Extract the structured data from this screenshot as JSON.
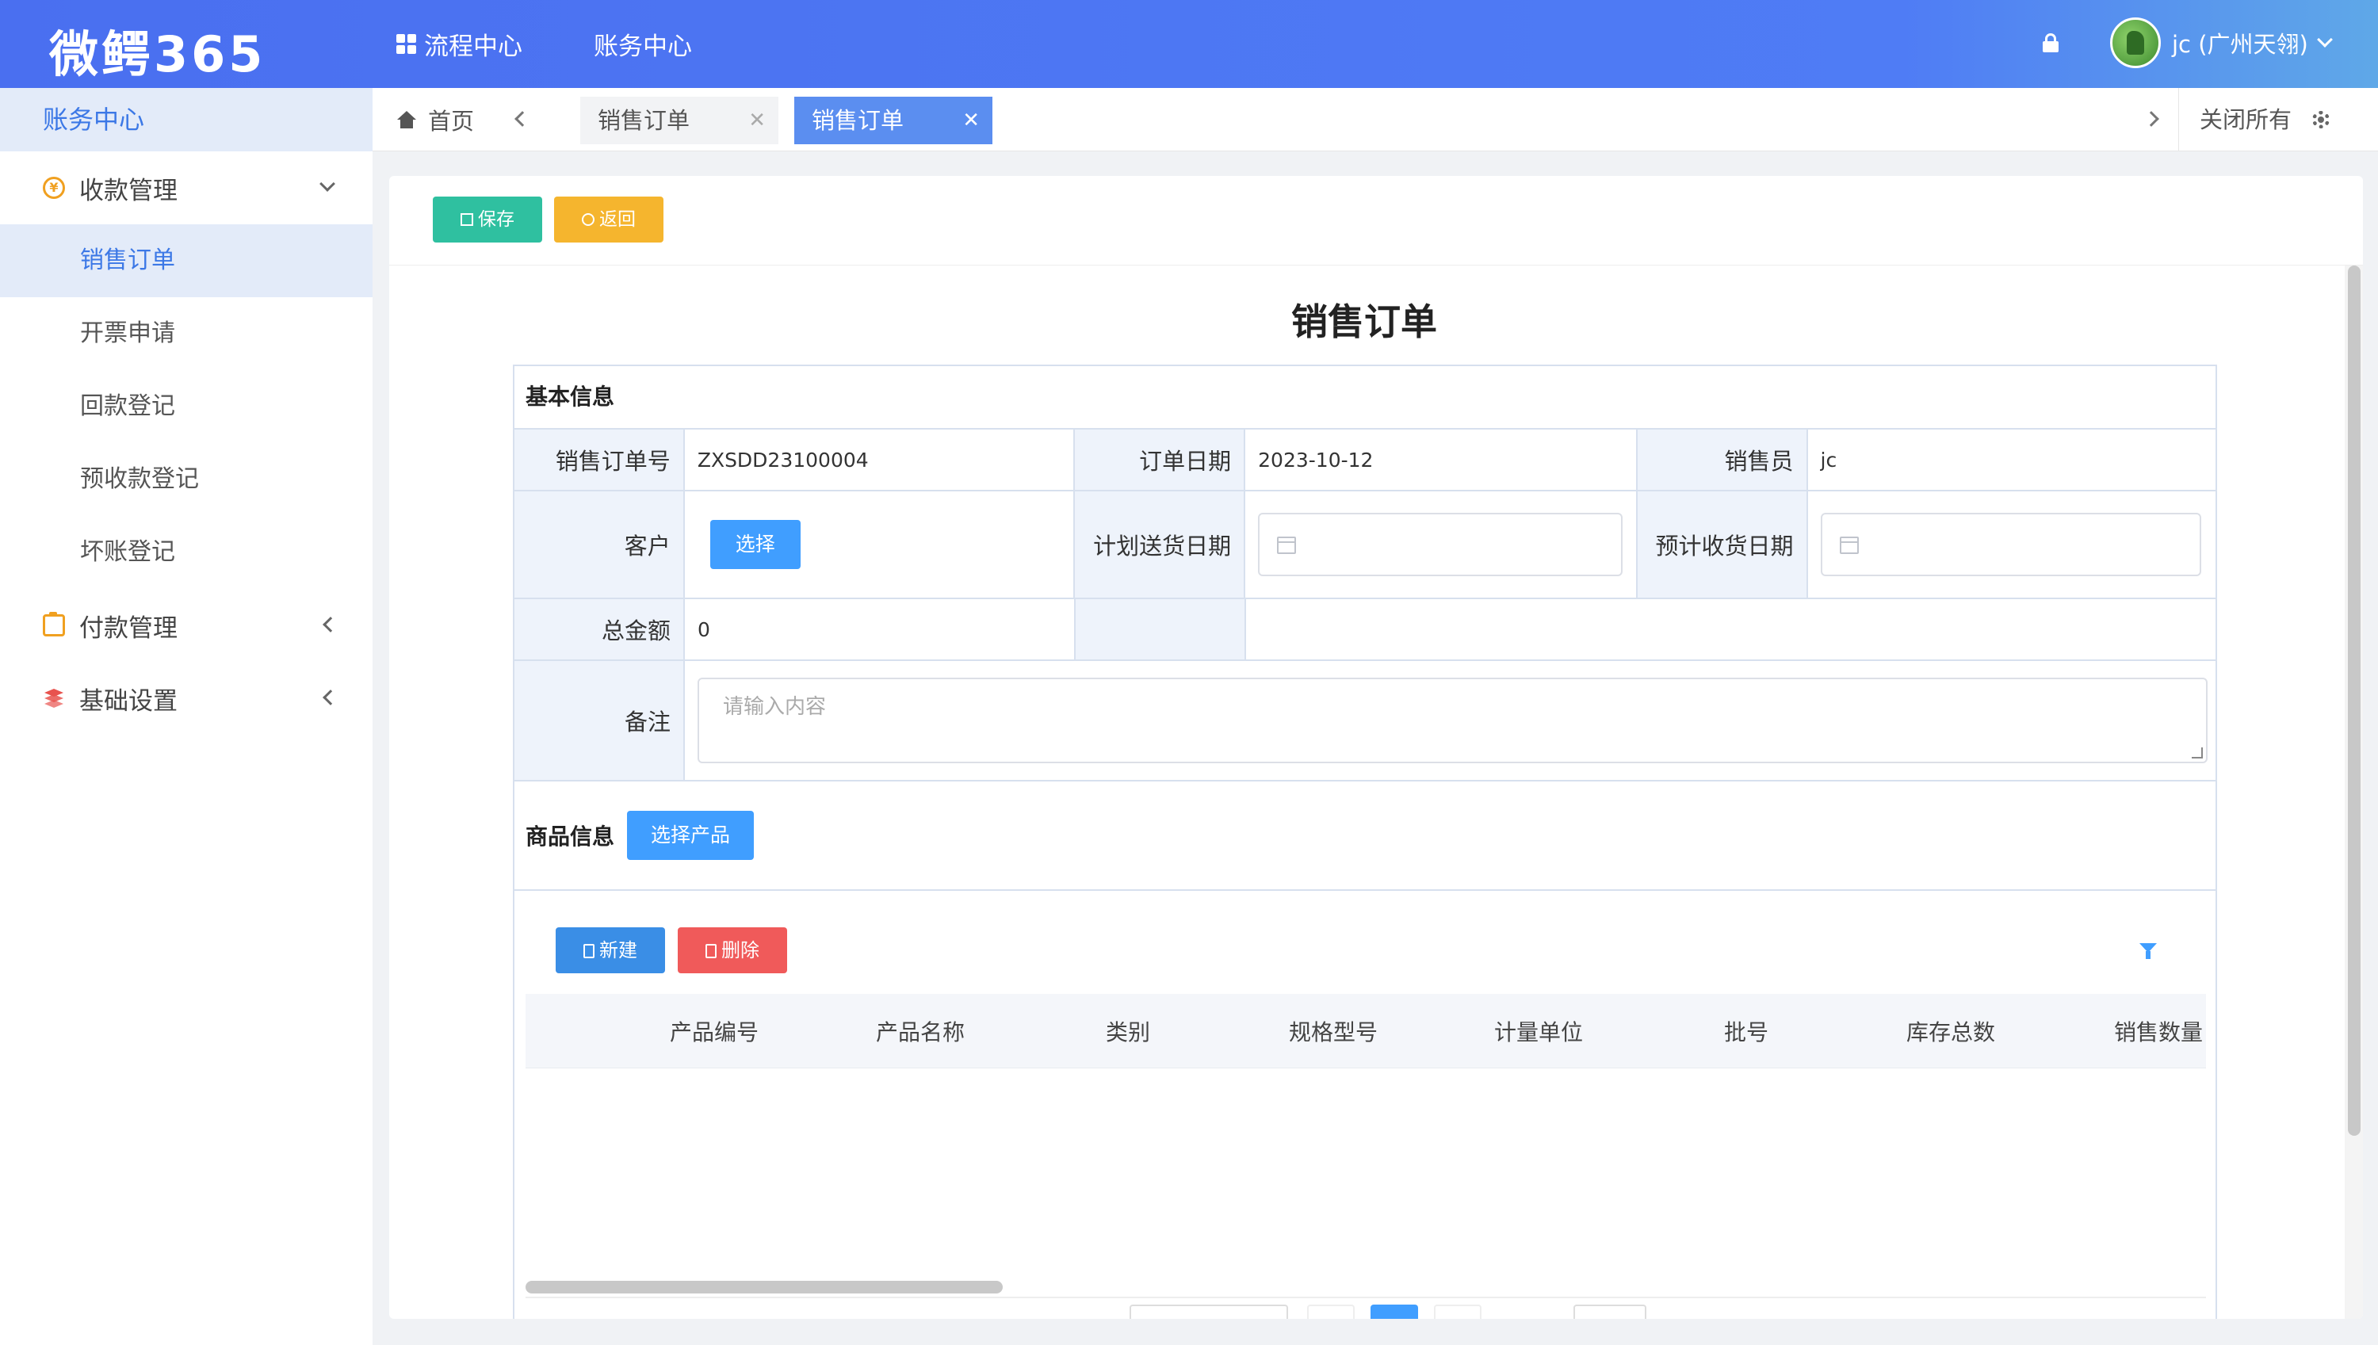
{
  "header": {
    "logo": "微鳄365",
    "nav": [
      {
        "label": "流程中心",
        "icon": "grid-icon"
      },
      {
        "label": "账务中心"
      }
    ],
    "user": "jc (广州天翎)",
    "lock_icon": "lock-icon"
  },
  "sidebar": {
    "title": "账务中心",
    "groups": [
      {
        "label": "收款管理",
        "icon": "yen-circle-icon",
        "expanded": true,
        "items": [
          "销售订单",
          "开票申请",
          "回款登记",
          "预收款登记",
          "坏账登记"
        ],
        "active": "销售订单"
      },
      {
        "label": "付款管理",
        "icon": "clipboard-icon",
        "expanded": false
      },
      {
        "label": "基础设置",
        "icon": "layers-icon",
        "expanded": false
      }
    ]
  },
  "tabs": {
    "home": "首页",
    "items": [
      {
        "label": "销售订单",
        "active": false
      },
      {
        "label": "销售订单",
        "active": true
      }
    ],
    "close_all": "关闭所有"
  },
  "toolbar": {
    "save": "保存",
    "back": "返回"
  },
  "form": {
    "title": "销售订单",
    "section_basic": "基本信息",
    "order_no_label": "销售订单号",
    "order_no": "ZXSDD23100004",
    "order_date_label": "订单日期",
    "order_date": "2023-10-12",
    "salesman_label": "销售员",
    "salesman": "jc",
    "customer_label": "客户",
    "customer_button": "选择",
    "plan_delivery_label": "计划送货日期",
    "expected_receipt_label": "预计收货日期",
    "total_label": "总金额",
    "total": "0",
    "remark_label": "备注",
    "remark_placeholder": "请输入内容",
    "section_goods": "商品信息",
    "pick_product": "选择产品"
  },
  "grid": {
    "new": "新建",
    "delete": "删除",
    "columns": [
      "产品编号",
      "产品名称",
      "类别",
      "规格型号",
      "计量单位",
      "批号",
      "库存总数",
      "销售数量"
    ]
  },
  "colors": {
    "header": "#4f7cf5",
    "accent": "#409eff",
    "save": "#2fc0a0",
    "back": "#f5b52e",
    "delete": "#f05a5a"
  }
}
